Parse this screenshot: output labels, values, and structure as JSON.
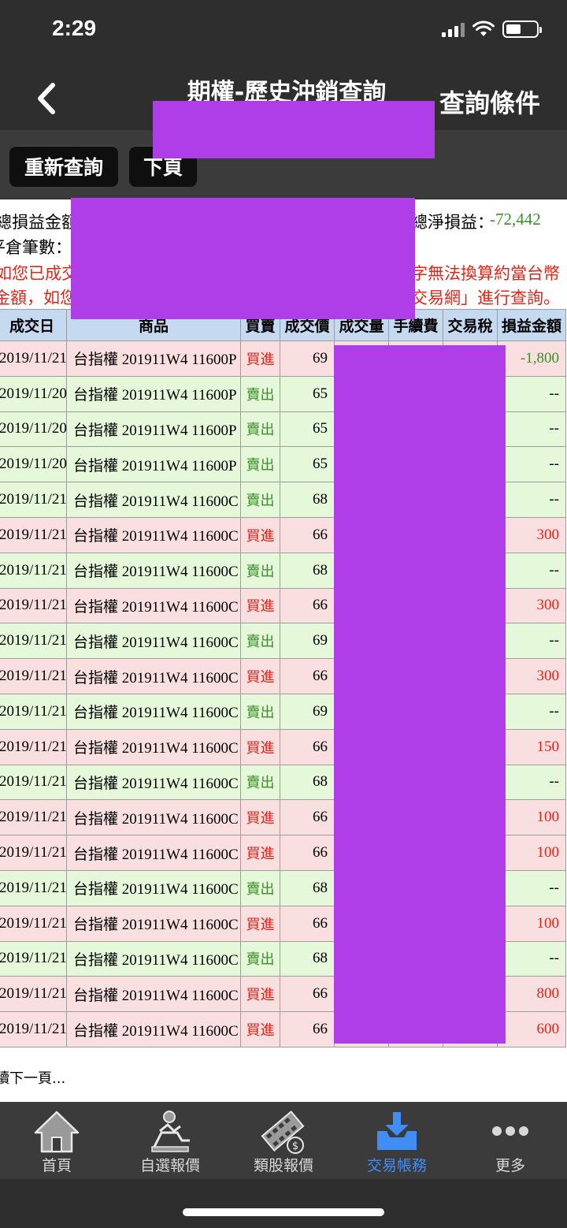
{
  "status": {
    "time": "2:29"
  },
  "nav": {
    "title": "期權-歷史沖銷查詢",
    "right_action": "查詢條件"
  },
  "toolbar": {
    "requery": "重新查詢",
    "next_page": "下頁"
  },
  "summary": {
    "total_pnl_label": "總損益金額",
    "net_pnl_label": "總淨損益：",
    "net_pnl_value": "-72,442",
    "close_count_label": "平倉筆數：",
    "notice_left_1": "如您已成交",
    "notice_right_1": "字無法換算約當台幣",
    "notice_left_2": "金額，如您",
    "notice_right_2": "交易網」進行查詢。"
  },
  "table": {
    "headers": [
      "成交日",
      "商品",
      "買賣",
      "成交價",
      "成交量",
      "手續費",
      "交易稅",
      "損益金額"
    ],
    "rows": [
      {
        "date": "2019/11/21",
        "product": "台指權 201911W4 11600P",
        "side": "買進",
        "price": "69",
        "pnl": "-1,800"
      },
      {
        "date": "2019/11/20",
        "product": "台指權 201911W4 11600P",
        "side": "賣出",
        "price": "65",
        "pnl": "--"
      },
      {
        "date": "2019/11/20",
        "product": "台指權 201911W4 11600P",
        "side": "賣出",
        "price": "65",
        "pnl": "--"
      },
      {
        "date": "2019/11/20",
        "product": "台指權 201911W4 11600P",
        "side": "賣出",
        "price": "65",
        "pnl": "--"
      },
      {
        "date": "2019/11/21",
        "product": "台指權 201911W4 11600C",
        "side": "賣出",
        "price": "68",
        "pnl": "--"
      },
      {
        "date": "2019/11/21",
        "product": "台指權 201911W4 11600C",
        "side": "買進",
        "price": "66",
        "pnl": "300"
      },
      {
        "date": "2019/11/21",
        "product": "台指權 201911W4 11600C",
        "side": "賣出",
        "price": "68",
        "pnl": "--"
      },
      {
        "date": "2019/11/21",
        "product": "台指權 201911W4 11600C",
        "side": "買進",
        "price": "66",
        "pnl": "300"
      },
      {
        "date": "2019/11/21",
        "product": "台指權 201911W4 11600C",
        "side": "賣出",
        "price": "69",
        "pnl": "--"
      },
      {
        "date": "2019/11/21",
        "product": "台指權 201911W4 11600C",
        "side": "買進",
        "price": "66",
        "pnl": "300"
      },
      {
        "date": "2019/11/21",
        "product": "台指權 201911W4 11600C",
        "side": "賣出",
        "price": "69",
        "pnl": "--"
      },
      {
        "date": "2019/11/21",
        "product": "台指權 201911W4 11600C",
        "side": "買進",
        "price": "66",
        "pnl": "150"
      },
      {
        "date": "2019/11/21",
        "product": "台指權 201911W4 11600C",
        "side": "賣出",
        "price": "68",
        "pnl": "--"
      },
      {
        "date": "2019/11/21",
        "product": "台指權 201911W4 11600C",
        "side": "買進",
        "price": "66",
        "pnl": "100"
      },
      {
        "date": "2019/11/21",
        "product": "台指權 201911W4 11600C",
        "side": "買進",
        "price": "66",
        "pnl": "100"
      },
      {
        "date": "2019/11/21",
        "product": "台指權 201911W4 11600C",
        "side": "賣出",
        "price": "68",
        "pnl": "--"
      },
      {
        "date": "2019/11/21",
        "product": "台指權 201911W4 11600C",
        "side": "買進",
        "price": "66",
        "pnl": "100"
      },
      {
        "date": "2019/11/21",
        "product": "台指權 201911W4 11600C",
        "side": "賣出",
        "price": "68",
        "pnl": "--"
      },
      {
        "date": "2019/11/21",
        "product": "台指權 201911W4 11600C",
        "side": "買進",
        "price": "66",
        "pnl": "800"
      },
      {
        "date": "2019/11/21",
        "product": "台指權 201911W4 11600C",
        "side": "買進",
        "price": "66",
        "pnl": "600"
      }
    ]
  },
  "footnote": "續下一頁...",
  "tabs": [
    {
      "label": "首頁",
      "icon": "home-icon"
    },
    {
      "label": "自選報價",
      "icon": "person-chart-icon"
    },
    {
      "label": "類股報價",
      "icon": "film-coin-icon"
    },
    {
      "label": "交易帳務",
      "icon": "tray-download-icon",
      "active": true
    },
    {
      "label": "更多",
      "icon": "more-dots-icon"
    }
  ],
  "colors": {
    "header_bg": "#c5d9f0",
    "buy_row": "#f9dfe0",
    "sell_row": "#e5f8d9",
    "buy_text": "#e0261a",
    "sell_text": "#3a8f28",
    "active_tab": "#3f8df5",
    "redaction": "#b03ee8"
  }
}
